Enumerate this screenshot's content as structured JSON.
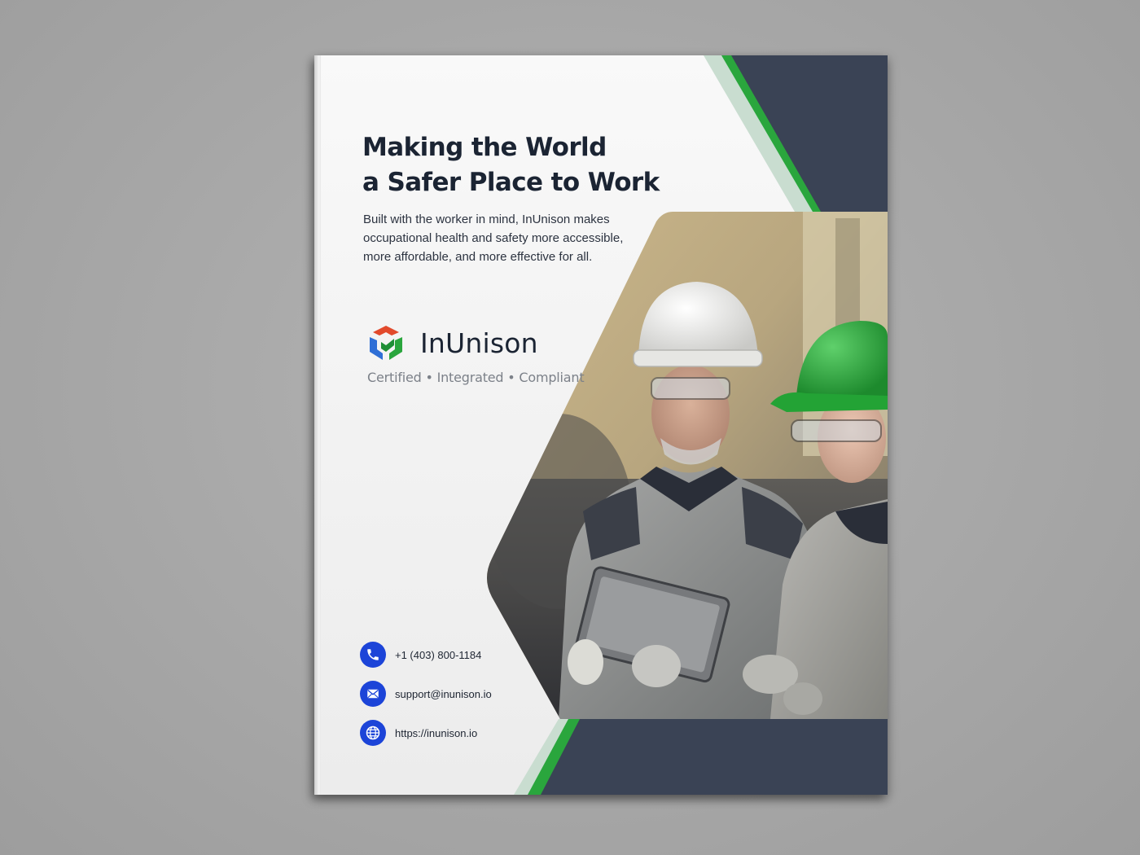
{
  "brochure": {
    "headline_line1": "Making the World",
    "headline_line2": "a Safer Place to Work",
    "intro": "Built with the worker in mind, InUnison makes occupational health and safety more accessible, more affordable, and more effective for all.",
    "brand_name": "InUnison",
    "tagline": "Certified • Integrated • Compliant",
    "contacts": [
      {
        "icon": "phone-icon",
        "text": "+1 (403) 800-1184"
      },
      {
        "icon": "mail-icon",
        "text": "support@inunison.io"
      },
      {
        "icon": "globe-icon",
        "text": "https://inunison.io"
      }
    ],
    "photo_subject": "workers-with-hard-hats-and-tablet"
  },
  "colors": {
    "background": "#a9a9a9",
    "navy": "#3a4355",
    "green": "#2aa63d",
    "light_green": "#c9ddd0",
    "icon_blue": "#1c44d8",
    "text_dark": "#1b2433",
    "tagline_gray": "#7c8189"
  }
}
